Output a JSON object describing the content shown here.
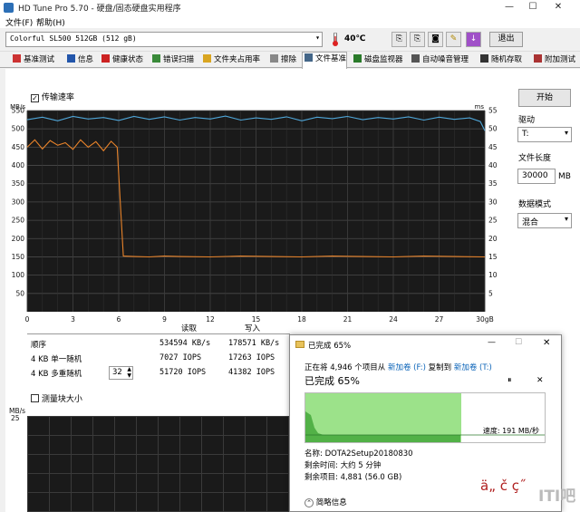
{
  "window": {
    "title": "HD Tune Pro 5.70 - 硬盘/固态硬盘实用程序",
    "minimize": "—",
    "maximize": "☐",
    "close": "✕"
  },
  "menu": {
    "file": "文件(F)",
    "help": "帮助(H)"
  },
  "toolbar": {
    "drive": "Colorful SL500 512GB (512 gB)",
    "temperature": "40℃",
    "exit_label": "退出"
  },
  "tabs": [
    {
      "label": "基准测试",
      "icon": "benchmark-icon",
      "color": "#cc3333"
    },
    {
      "label": "信息",
      "icon": "info-icon",
      "color": "#2255aa"
    },
    {
      "label": "健康状态",
      "icon": "health-icon",
      "color": "#cc2222"
    },
    {
      "label": "错误扫描",
      "icon": "error-scan-icon",
      "color": "#3a8a3a"
    },
    {
      "label": "文件夹占用率",
      "icon": "folder-icon",
      "color": "#d9a521"
    },
    {
      "label": "擦除",
      "icon": "erase-icon",
      "color": "#888888"
    },
    {
      "label": "文件基准",
      "icon": "file-benchmark-icon",
      "color": "#446688"
    },
    {
      "label": "磁盘监视器",
      "icon": "disk-monitor-icon",
      "color": "#2a7a2a"
    },
    {
      "label": "自动噪音管理",
      "icon": "noise-icon",
      "color": "#555555"
    },
    {
      "label": "随机存取",
      "icon": "random-access-icon",
      "color": "#333333"
    },
    {
      "label": "附加测试",
      "icon": "extra-tests-icon",
      "color": "#aa3333"
    }
  ],
  "benchmark": {
    "transfer_rate_label": "传输速率",
    "block_size_label": "测量块大小",
    "start_label": "开始",
    "drive_label": "驱动",
    "drive_value": "T:",
    "file_length_label": "文件长度",
    "file_length_value": "30000",
    "file_length_unit": "MB",
    "data_mode_label": "数据模式",
    "data_mode_value": "混合",
    "col_read": "读取",
    "col_write": "写入",
    "rows": [
      {
        "label": "顺序",
        "read": "534594 KB/s",
        "write": "178571 KB/s"
      },
      {
        "label": "4 KB 单一随机",
        "read": "7027 IOPS",
        "write": "17263 IOPS"
      },
      {
        "label": "4 KB 多重随机",
        "read": "51720 IOPS",
        "write": "41382 IOPS"
      }
    ],
    "queue_depth": "32",
    "lower_chart_unit": "MB/s",
    "lower_chart_max": "25"
  },
  "chart_data": {
    "type": "line",
    "y_left_unit": "MB/s",
    "y_right_unit": "ms",
    "ylim": [
      0,
      550
    ],
    "y_right_lim": [
      0,
      55
    ],
    "y_ticks": [
      50,
      100,
      150,
      200,
      250,
      300,
      350,
      400,
      450,
      500,
      550
    ],
    "y_right_ticks": [
      5,
      10,
      15,
      20,
      25,
      30,
      35,
      40,
      45,
      50,
      55
    ],
    "x_ticks": [
      "0",
      "3",
      "6",
      "9",
      "12",
      "15",
      "18",
      "21",
      "24",
      "27",
      "30gB"
    ],
    "xlim": [
      0,
      30
    ],
    "grid": true,
    "series": [
      {
        "color": "#4fa6d8",
        "x": [
          0,
          1,
          2,
          3,
          4,
          5,
          6,
          7,
          8,
          9,
          10,
          11,
          12,
          13,
          14,
          15,
          16,
          17,
          18,
          19,
          20,
          21,
          22,
          23,
          24,
          25,
          26,
          27,
          28,
          29,
          29.7,
          30
        ],
        "y": [
          525,
          532,
          522,
          534,
          527,
          531,
          523,
          534,
          526,
          533,
          524,
          531,
          527,
          535,
          524,
          530,
          526,
          533,
          522,
          532,
          528,
          534,
          525,
          531,
          527,
          533,
          524,
          532,
          526,
          530,
          520,
          495
        ]
      },
      {
        "color": "#e8832a",
        "x": [
          0,
          0.5,
          1,
          1.5,
          2,
          2.5,
          3,
          3.5,
          4,
          4.5,
          5,
          5.5,
          5.9,
          6.1,
          6.3,
          7,
          8,
          9,
          10,
          12,
          14,
          16,
          18,
          20,
          22,
          24,
          26,
          28,
          30
        ],
        "y": [
          450,
          470,
          445,
          468,
          455,
          462,
          444,
          470,
          450,
          465,
          440,
          466,
          450,
          300,
          152,
          151,
          150,
          152,
          151,
          150,
          152,
          151,
          150,
          152,
          151,
          150,
          152,
          151,
          150
        ]
      }
    ]
  },
  "copy_dialog": {
    "title": "已完成 65%",
    "line1_prefix": "正在将 4,946 个项目从",
    "source": "新加卷 (F:)",
    "line1_middle": "复制到",
    "dest": "新加卷 (T:)",
    "progress_text": "已完成 65%",
    "progress_fraction": 0.65,
    "speed": "速度: 191 MB/秒",
    "name_label": "名称: DOTA2Setup20180830",
    "time_label": "剩余时间: 大约 5 分钟",
    "items_label": "剩余项目: 4,881 (56.0 GB)",
    "details_label": "简略信息",
    "pause": "⏸",
    "cancel": "✕"
  },
  "overlay": {
    "garbled_text": "ä„ č ç˝",
    "watermark": "ITI吧"
  }
}
